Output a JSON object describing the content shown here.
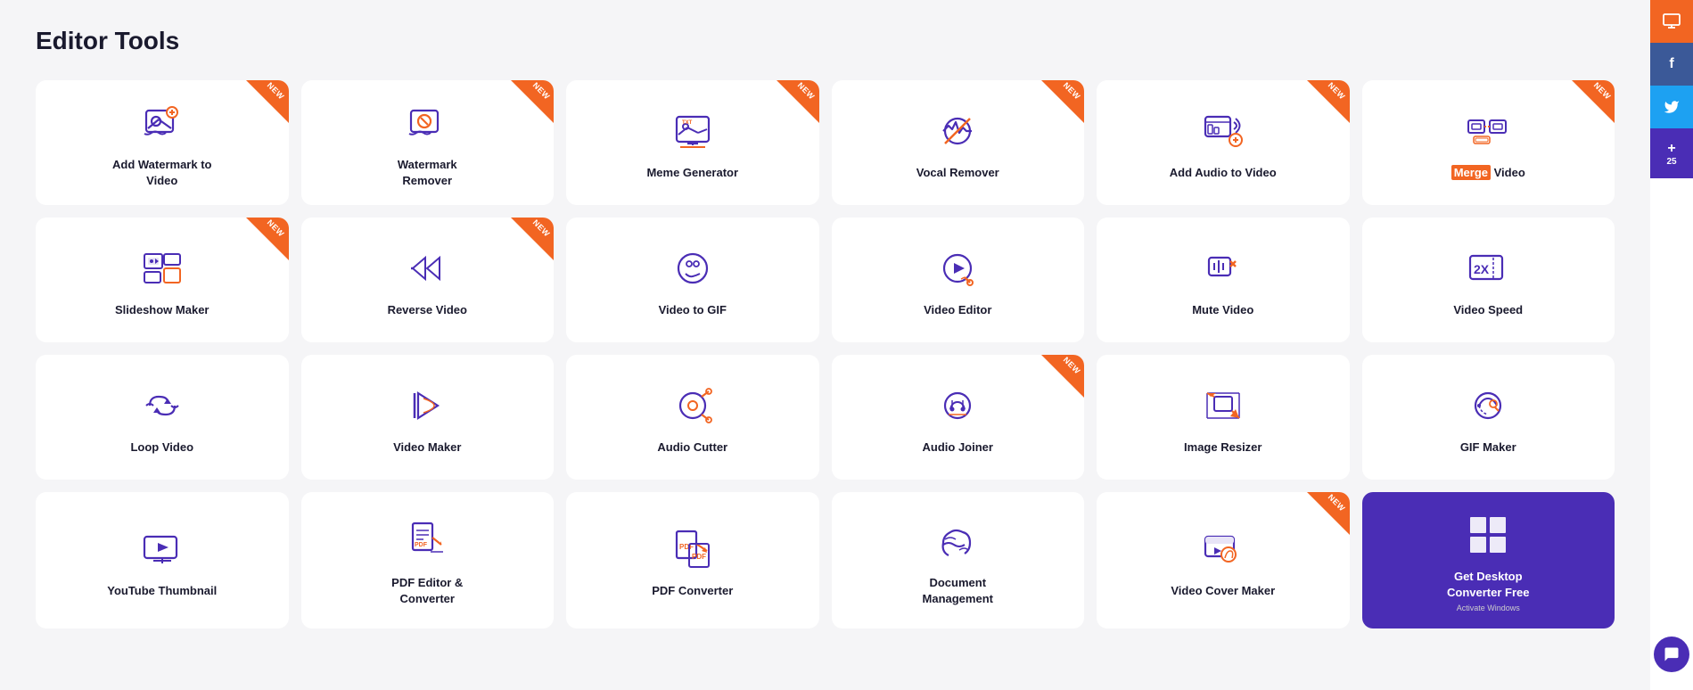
{
  "page": {
    "title": "Editor Tools"
  },
  "sidebar": {
    "monitor_icon": "🖥",
    "facebook_icon": "f",
    "twitter_icon": "🐦",
    "share_icon": "+",
    "share_count": "25",
    "chat_icon": "💬"
  },
  "tools": [
    {
      "id": "add-watermark",
      "label": "Add Watermark to\nVideo",
      "new": true,
      "icon": "watermark-add"
    },
    {
      "id": "watermark-remover",
      "label": "Watermark\nRemover",
      "new": true,
      "icon": "watermark-remove"
    },
    {
      "id": "meme-generator",
      "label": "Meme Generator",
      "new": true,
      "icon": "meme"
    },
    {
      "id": "vocal-remover",
      "label": "Vocal Remover",
      "new": true,
      "icon": "vocal"
    },
    {
      "id": "add-audio-video",
      "label": "Add Audio to Video",
      "new": true,
      "icon": "audio-add"
    },
    {
      "id": "merge-video",
      "label": "Merge Video",
      "new": true,
      "icon": "merge",
      "highlight": true
    },
    {
      "id": "slideshow-maker",
      "label": "Slideshow Maker",
      "new": true,
      "icon": "slideshow"
    },
    {
      "id": "reverse-video",
      "label": "Reverse Video",
      "new": true,
      "icon": "reverse"
    },
    {
      "id": "video-to-gif",
      "label": "Video to GIF",
      "new": false,
      "icon": "gif"
    },
    {
      "id": "video-editor",
      "label": "Video Editor",
      "new": false,
      "icon": "video-edit"
    },
    {
      "id": "mute-video",
      "label": "Mute Video",
      "new": false,
      "icon": "mute"
    },
    {
      "id": "video-speed",
      "label": "Video Speed",
      "new": false,
      "icon": "speed"
    },
    {
      "id": "loop-video",
      "label": "Loop Video",
      "new": false,
      "icon": "loop"
    },
    {
      "id": "video-maker",
      "label": "Video Maker",
      "new": false,
      "icon": "video-maker"
    },
    {
      "id": "audio-cutter",
      "label": "Audio Cutter",
      "new": false,
      "icon": "audio-cut"
    },
    {
      "id": "audio-joiner",
      "label": "Audio Joiner",
      "new": true,
      "icon": "audio-join"
    },
    {
      "id": "image-resizer",
      "label": "Image Resizer",
      "new": false,
      "icon": "resize"
    },
    {
      "id": "gif-maker",
      "label": "GIF Maker",
      "new": false,
      "icon": "gif-maker"
    },
    {
      "id": "youtube-thumbnail",
      "label": "YouTube Thumbnail",
      "new": false,
      "icon": "youtube"
    },
    {
      "id": "pdf-editor",
      "label": "PDF Editor &\nConverter",
      "new": false,
      "icon": "pdf-edit"
    },
    {
      "id": "pdf-converter",
      "label": "PDF Converter",
      "new": false,
      "icon": "pdf-convert"
    },
    {
      "id": "document-management",
      "label": "Document\nManagement",
      "new": false,
      "icon": "document"
    },
    {
      "id": "video-cover-maker",
      "label": "Video Cover Maker",
      "new": true,
      "icon": "video-cover"
    },
    {
      "id": "get-desktop",
      "label": "Get Desktop\nConverter Free",
      "new": false,
      "icon": "desktop",
      "special": "promo"
    }
  ]
}
